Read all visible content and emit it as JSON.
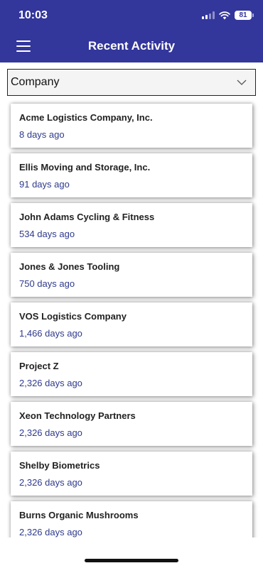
{
  "status_bar": {
    "time": "10:03",
    "battery": "81"
  },
  "header": {
    "title": "Recent Activity",
    "menu_icon": "hamburger-icon",
    "background": "#33369b"
  },
  "filter": {
    "selected": "Company",
    "icon": "chevron-down-icon"
  },
  "items": [
    {
      "name": "Acme Logistics Company, Inc.",
      "ago": "8 days ago"
    },
    {
      "name": "Ellis Moving and Storage, Inc.",
      "ago": "91 days ago"
    },
    {
      "name": "John Adams Cycling & Fitness",
      "ago": "534 days ago"
    },
    {
      "name": "Jones & Jones Tooling",
      "ago": "750 days ago"
    },
    {
      "name": "VOS Logistics Company",
      "ago": "1,466 days ago"
    },
    {
      "name": "Project Z",
      "ago": "2,326 days ago"
    },
    {
      "name": "Xeon Technology Partners",
      "ago": "2,326 days ago"
    },
    {
      "name": "Shelby Biometrics",
      "ago": "2,326 days ago"
    },
    {
      "name": "Burns Organic Mushrooms",
      "ago": "2,326 days ago"
    }
  ]
}
